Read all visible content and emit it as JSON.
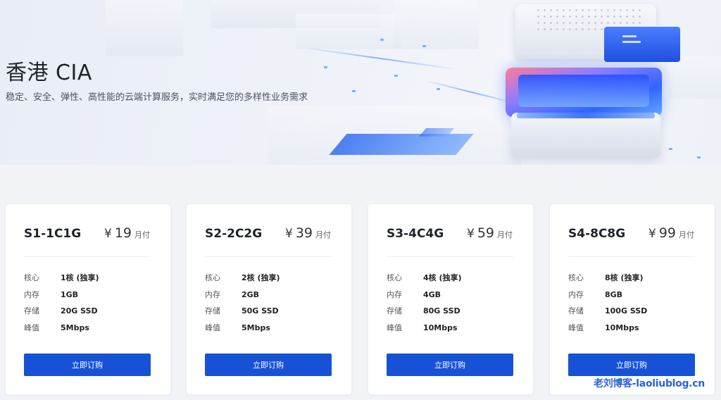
{
  "hero": {
    "title": "香港 CIA",
    "subtitle": "稳定、安全、弹性、高性能的云端计算服务，实时满足您的多样性业务需求"
  },
  "spec_labels": {
    "cores": "核心",
    "memory": "内存",
    "storage": "存储",
    "bandwidth": "峰值"
  },
  "plans": [
    {
      "name": "S1-1C1G",
      "currency": "¥",
      "price": "19",
      "unit": "月付",
      "cores": "1核 (独享)",
      "memory": "1GB",
      "storage": "20G SSD",
      "bandwidth": "5Mbps",
      "button": "立即订购"
    },
    {
      "name": "S2-2C2G",
      "currency": "¥",
      "price": "39",
      "unit": "月付",
      "cores": "2核 (独享)",
      "memory": "2GB",
      "storage": "50G SSD",
      "bandwidth": "5Mbps",
      "button": "立即订购"
    },
    {
      "name": "S3-4C4G",
      "currency": "¥",
      "price": "59",
      "unit": "月付",
      "cores": "4核 (独享)",
      "memory": "4GB",
      "storage": "80G SSD",
      "bandwidth": "10Mbps",
      "button": "立即订购"
    },
    {
      "name": "S4-8C8G",
      "currency": "¥",
      "price": "99",
      "unit": "月付",
      "cores": "8核 (独享)",
      "memory": "8GB",
      "storage": "100G SSD",
      "bandwidth": "10Mbps",
      "button": "立即订购"
    }
  ],
  "watermark": "老刘博客-laoliublog.cn",
  "colors": {
    "accent": "#1752d6",
    "background": "#f1f3f7",
    "card": "#ffffff"
  }
}
